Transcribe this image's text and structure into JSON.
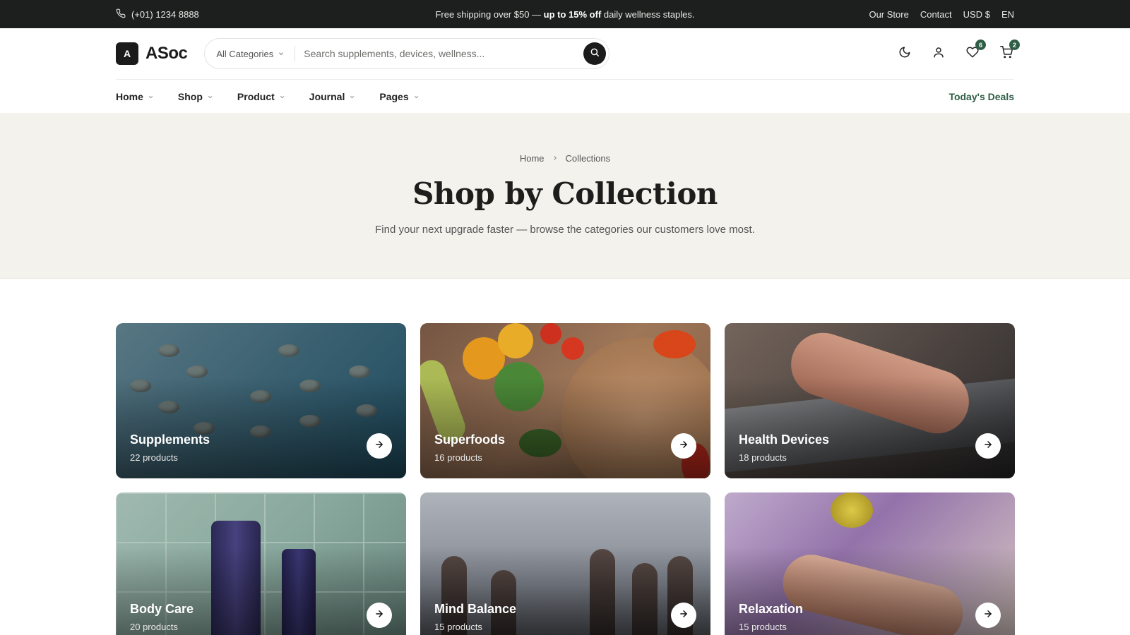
{
  "topbar": {
    "phone": "(+01) 1234 8888",
    "promo_prefix": "Free shipping over $50 — ",
    "promo_bold": "up to 15% off",
    "promo_suffix": " daily wellness staples.",
    "links": [
      "Our Store",
      "Contact",
      "USD $",
      "EN"
    ]
  },
  "header": {
    "logo_mark": "A",
    "logo_text": "ASoc",
    "category_label": "All Categories",
    "search_placeholder": "Search supplements, devices, wellness...",
    "wishlist_count": "6",
    "cart_count": "2"
  },
  "nav": {
    "items": [
      "Home",
      "Shop",
      "Product",
      "Journal",
      "Pages"
    ],
    "deals": "Today's Deals"
  },
  "hero": {
    "breadcrumb_home": "Home",
    "breadcrumb_current": "Collections",
    "title": "Shop by Collection",
    "subtitle": "Find your next upgrade faster — browse the categories our customers love most."
  },
  "collections": [
    {
      "name": "Supplements",
      "count": "22 products"
    },
    {
      "name": "Superfoods",
      "count": "16 products"
    },
    {
      "name": "Health Devices",
      "count": "18 products"
    },
    {
      "name": "Body Care",
      "count": "20 products"
    },
    {
      "name": "Mind Balance",
      "count": "15 products"
    },
    {
      "name": "Relaxation",
      "count": "15 products"
    }
  ],
  "colors": {
    "topbar_bg": "#1d1f1e",
    "accent": "#2f5e46",
    "hero_bg": "#f3f2ed"
  },
  "icons": {
    "phone": "phone-icon",
    "search": "search-icon",
    "theme": "moon-icon",
    "account": "user-icon",
    "wishlist": "heart-icon",
    "cart": "cart-icon",
    "card_arrow": "arrow-right-icon"
  }
}
